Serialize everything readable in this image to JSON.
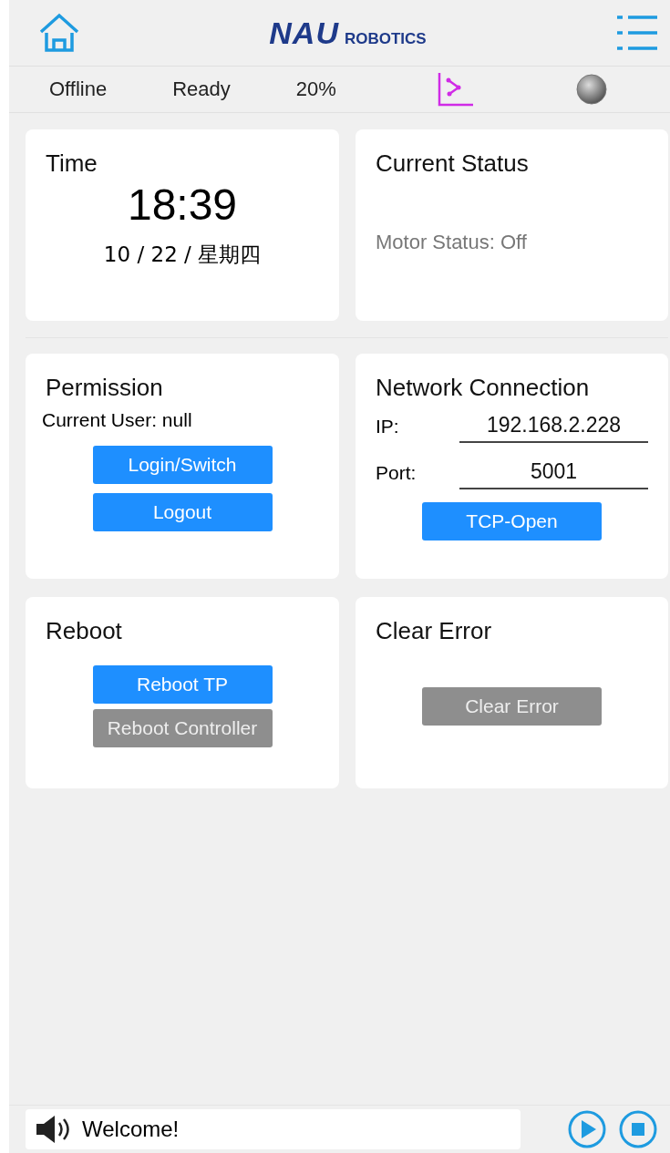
{
  "header": {
    "logo": "NAU",
    "logo_sub": "ROBOTICS"
  },
  "status_bar": {
    "connection": "Offline",
    "state": "Ready",
    "speed": "20%",
    "indicator_on": false
  },
  "time_card": {
    "title": "Time",
    "time": "18:39",
    "date": "10 / 22 / 星期四"
  },
  "status_card": {
    "title": "Current Status",
    "motor_status": "Motor Status: Off"
  },
  "permission_card": {
    "title": "Permission",
    "current_user": "Current User: null",
    "buttons": [
      {
        "label": "Login/Switch",
        "disabled": false
      },
      {
        "label": "Logout",
        "disabled": false
      }
    ]
  },
  "network_card": {
    "title": "Network Connection",
    "fields": [
      {
        "label": "IP:",
        "value": "192.168.2.228"
      },
      {
        "label": "Port:",
        "value": "5001"
      }
    ],
    "buttons": [
      {
        "label": "TCP-Open",
        "disabled": false
      }
    ]
  },
  "reboot_card": {
    "title": "Reboot",
    "buttons": [
      {
        "label": "Reboot TP",
        "disabled": false
      },
      {
        "label": "Reboot Controller",
        "disabled": true
      }
    ]
  },
  "clear_error_card": {
    "title": "Clear Error",
    "buttons": [
      {
        "label": "Clear Error",
        "disabled": true
      }
    ]
  },
  "message_bar": {
    "message": "Welcome!"
  }
}
